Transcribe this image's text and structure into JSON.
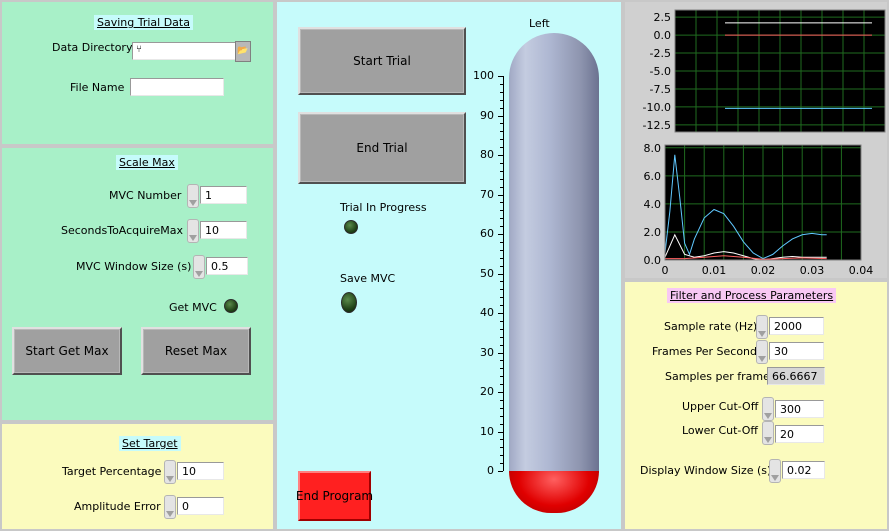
{
  "saving": {
    "title": "Saving Trial Data",
    "data_directory_label": "Data Directory",
    "data_directory_value": "",
    "file_name_label": "File Name",
    "file_name_value": ""
  },
  "scale": {
    "title": "Scale Max",
    "mvc_number_label": "MVC Number",
    "mvc_number_value": "1",
    "seconds_label": "SecondsToAcquireMax",
    "seconds_value": "10",
    "window_label": "MVC Window Size (s)",
    "window_value": "0.5",
    "get_mvc_label": "Get MVC",
    "start_get_max": "Start Get Max",
    "reset_max": "Reset Max"
  },
  "target": {
    "title": "Set Target",
    "percentage_label": "Target Percentage",
    "percentage_value": "10",
    "amplitude_label": "Amplitude Error",
    "amplitude_value": "0"
  },
  "center": {
    "start_trial": "Start Trial",
    "end_trial": "End Trial",
    "trial_in_progress": "Trial In Progress",
    "save_mvc": "Save MVC",
    "end_program": "End Program"
  },
  "thermometer": {
    "title": "Left",
    "ticks": [
      "100",
      "90",
      "80",
      "70",
      "60",
      "50",
      "40",
      "30",
      "20",
      "10",
      "0"
    ],
    "value": 0
  },
  "filter": {
    "title": "Filter and Process Parameters",
    "sample_rate_label": "Sample rate (Hz)",
    "sample_rate_value": "2000",
    "fps_label": "Frames Per Second",
    "fps_value": "30",
    "spf_label": "Samples per frame",
    "spf_value": "66.6667",
    "upper_label": "Upper Cut-Off",
    "upper_value": "300",
    "lower_label": "Lower Cut-Off",
    "lower_value": "20",
    "display_label": "Display Window Size (s)",
    "display_value": "0.02"
  },
  "colors": {
    "green_panel": "#a8f0c8",
    "cyan_panel": "#c6fbfb",
    "yellow_panel": "#fbfbbe",
    "end_program": "#ff2020"
  },
  "chart_data": [
    {
      "type": "line",
      "y_ticks": [
        "2.5",
        "0.0",
        "-2.5",
        "-5.0",
        "-7.5",
        "-10.0",
        "-12.5"
      ],
      "ylim": [
        -13.5,
        3.5
      ],
      "grid": true,
      "series": [
        {
          "color": "#ffffff",
          "values": [
            1.7,
            1.7
          ]
        },
        {
          "color": "#ff6060",
          "values": [
            0.0,
            0.0
          ]
        },
        {
          "color": "#60c8ff",
          "values": [
            -10.2,
            -10.2
          ]
        }
      ]
    },
    {
      "type": "line",
      "x_ticks": [
        "0",
        "0.01",
        "0.02",
        "0.03",
        "0.04"
      ],
      "y_ticks": [
        "8.0",
        "6.0",
        "4.0",
        "2.0",
        "0.0"
      ],
      "xlim": [
        0,
        0.04
      ],
      "ylim": [
        0,
        8.2
      ],
      "grid": true,
      "series": [
        {
          "color": "#60c8ff",
          "x": [
            0,
            0.001,
            0.002,
            0.003,
            0.004,
            0.005,
            0.006,
            0.008,
            0.01,
            0.012,
            0.014,
            0.016,
            0.018,
            0.02,
            0.022,
            0.024,
            0.026,
            0.028,
            0.03,
            0.032,
            0.033
          ],
          "y": [
            0.5,
            3.5,
            7.5,
            4.5,
            1.2,
            0.4,
            1.5,
            3.0,
            3.6,
            3.3,
            2.4,
            1.3,
            0.5,
            0.1,
            0.4,
            1.0,
            1.5,
            1.8,
            1.9,
            1.8,
            1.8
          ]
        },
        {
          "color": "#ffffff",
          "x": [
            0,
            0.002,
            0.004,
            0.006,
            0.008,
            0.01,
            0.012,
            0.014,
            0.016,
            0.018,
            0.02,
            0.022,
            0.024,
            0.026,
            0.028,
            0.03,
            0.033
          ],
          "y": [
            0.2,
            1.8,
            0.4,
            0.2,
            0.3,
            0.5,
            0.6,
            0.5,
            0.3,
            0.1,
            0.0,
            0.1,
            0.2,
            0.25,
            0.2,
            0.2,
            0.2
          ]
        },
        {
          "color": "#ff6060",
          "x": [
            0,
            0.004,
            0.008,
            0.012,
            0.016,
            0.02,
            0.024,
            0.028,
            0.033
          ],
          "y": [
            0.1,
            0.1,
            0.2,
            0.3,
            0.2,
            0.05,
            0.1,
            0.15,
            0.1
          ]
        }
      ]
    }
  ]
}
